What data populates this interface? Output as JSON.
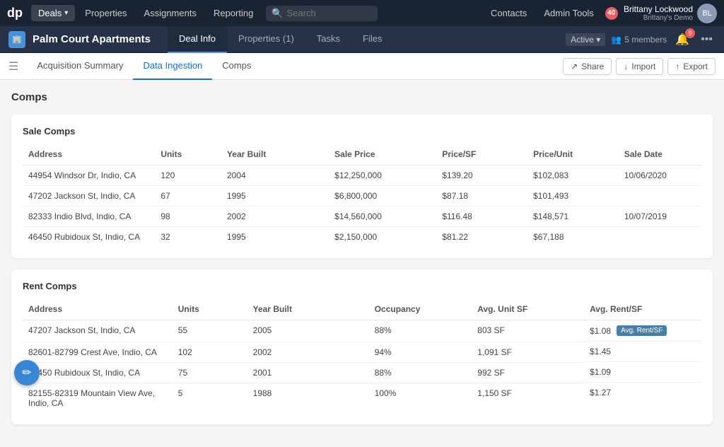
{
  "topNav": {
    "logo": "dp",
    "items": [
      {
        "label": "Deals",
        "hasChevron": true,
        "active": true
      },
      {
        "label": "Properties",
        "active": false
      },
      {
        "label": "Assignments",
        "active": false
      },
      {
        "label": "Reporting",
        "active": false
      }
    ],
    "search": {
      "placeholder": "Search"
    },
    "contactsLabel": "Contacts",
    "adminLabel": "Admin Tools",
    "notificationCount": "40",
    "user": {
      "name": "Brittany Lockwood",
      "demo": "Brittany's Demo"
    }
  },
  "dealHeader": {
    "iconText": "🏢",
    "title": "Palm Court Apartments",
    "tabs": [
      {
        "label": "Deal Info",
        "active": true
      },
      {
        "label": "Properties (1)",
        "active": false
      },
      {
        "label": "Tasks",
        "active": false
      },
      {
        "label": "Files",
        "active": false
      }
    ],
    "status": "Active",
    "members": "5 members",
    "notifCount": "9"
  },
  "subNav": {
    "tabs": [
      {
        "label": "Acquisition Summary",
        "active": false
      },
      {
        "label": "Data Ingestion",
        "active": true
      },
      {
        "label": "Comps",
        "active": false
      }
    ],
    "actions": [
      {
        "label": "Share",
        "icon": "↗"
      },
      {
        "label": "Import",
        "icon": "↓"
      },
      {
        "label": "Export",
        "icon": "↑"
      }
    ]
  },
  "pageTitle": "Comps",
  "saleComps": {
    "title": "Sale Comps",
    "columns": [
      "Address",
      "Units",
      "Year Built",
      "Sale Price",
      "Price/SF",
      "Price/Unit",
      "Sale Date"
    ],
    "rows": [
      {
        "address": "44954 Windsor Dr, Indio, CA",
        "units": "120",
        "yearBuilt": "2004",
        "salePrice": "$12,250,000",
        "priceSF": "$139.20",
        "priceUnit": "$102,083",
        "saleDate": "10/06/2020"
      },
      {
        "address": "47202 Jackson St, Indio, CA",
        "units": "67",
        "yearBuilt": "1995",
        "salePrice": "$6,800,000",
        "priceSF": "$87.18",
        "priceUnit": "$101,493",
        "saleDate": ""
      },
      {
        "address": "82333 Indio Blvd, Indio, CA",
        "units": "98",
        "yearBuilt": "2002",
        "salePrice": "$14,560,000",
        "priceSF": "$116.48",
        "priceUnit": "$148,571",
        "saleDate": "10/07/2019"
      },
      {
        "address": "46450 Rubidoux St, Indio, CA",
        "units": "32",
        "yearBuilt": "1995",
        "salePrice": "$2,150,000",
        "priceSF": "$81.22",
        "priceUnit": "$67,188",
        "saleDate": ""
      }
    ]
  },
  "rentComps": {
    "title": "Rent Comps",
    "columns": [
      "Address",
      "Units",
      "Year Built",
      "Occupancy",
      "Avg. Unit SF",
      "Avg. Rent/SF"
    ],
    "tooltip": "Avg. Rent/SF",
    "rows": [
      {
        "address": "47207 Jackson St, Indio, CA",
        "units": "55",
        "yearBuilt": "2005",
        "occupancy": "88%",
        "avgUnitSF": "803 SF",
        "avgRentSF": "$1.08"
      },
      {
        "address": "82601-82799 Crest Ave, Indio, CA",
        "units": "102",
        "yearBuilt": "2002",
        "occupancy": "94%",
        "avgUnitSF": "1,091 SF",
        "avgRentSF": "$1.45"
      },
      {
        "address": "46450 Rubidoux St, Indio, CA",
        "units": "75",
        "yearBuilt": "2001",
        "occupancy": "88%",
        "avgUnitSF": "992 SF",
        "avgRentSF": "$1.09"
      },
      {
        "address": "82155-82319 Mountain View Ave, Indio, CA",
        "units": "5",
        "yearBuilt": "1988",
        "occupancy": "100%",
        "avgUnitSF": "1,150 SF",
        "avgRentSF": "$1.27"
      }
    ]
  },
  "fab": {
    "icon": "✏"
  }
}
